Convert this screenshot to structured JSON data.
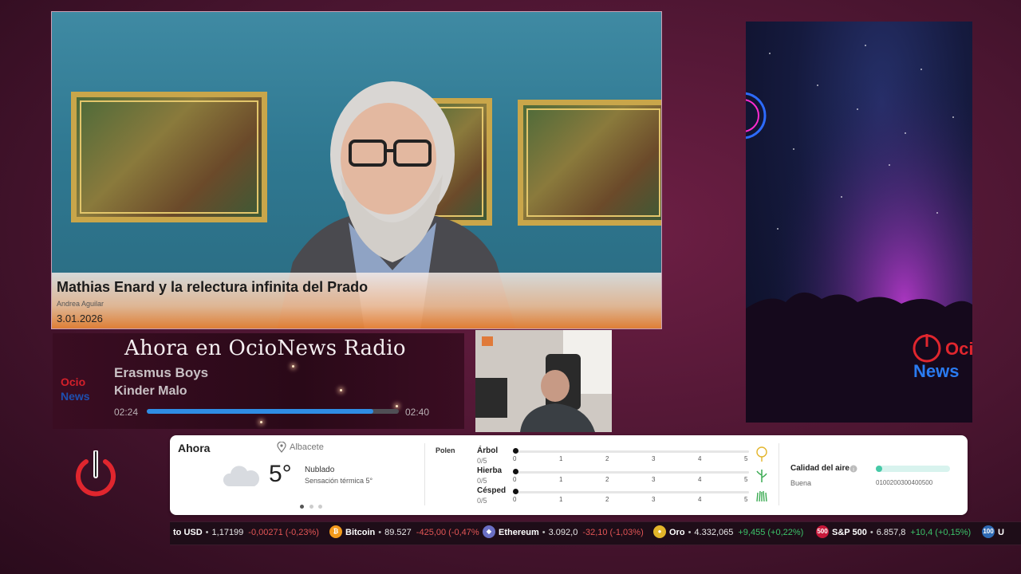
{
  "news": {
    "title": "Mathias Enard y la relectura infinita del Prado",
    "author": "Andrea Aguilar",
    "date": "3.01.2026"
  },
  "radio": {
    "heading": "Ahora en OcioNews Radio",
    "artist": "Erasmus Boys",
    "song": "Kinder Malo",
    "time_elapsed": "02:24",
    "time_total": "02:40",
    "progress_fraction": 0.9
  },
  "side_video": {
    "logo_top": "Ocio",
    "logo_bottom": "News"
  },
  "weather": {
    "now_label": "Ahora",
    "location": "Albacete",
    "temperature": "5°",
    "condition": "Nublado",
    "feels_like": "Sensación térmica 5°",
    "pollen_label": "Polen",
    "pollen": [
      {
        "name": "Árbol",
        "score": "0/5",
        "value": 0
      },
      {
        "name": "Hierba",
        "score": "0/5",
        "value": 0
      },
      {
        "name": "Césped",
        "score": "0/5",
        "value": 0
      }
    ],
    "scale": [
      "0",
      "1",
      "2",
      "3",
      "4",
      "5"
    ],
    "air_quality_label": "Calidad del aire",
    "air_quality_value": "Buena",
    "air_quality_scale": "0100200300400500"
  },
  "ticker": [
    {
      "name": "to USD",
      "value": "1,17199",
      "change": "-0,00271 (-0,23%)",
      "direction": "neg",
      "icon": ""
    },
    {
      "name": "Bitcoin",
      "value": "89.527",
      "change": "-425,00 (-0,47%",
      "direction": "neg",
      "icon": "bitcoin-icon"
    },
    {
      "name": "Ethereum",
      "value": "3.092,0",
      "change": "-32,10 (-1,03%)",
      "direction": "neg",
      "icon": "ethereum-icon"
    },
    {
      "name": "Oro",
      "value": "4.332,065",
      "change": "+9,455 (+0,22%)",
      "direction": "pos",
      "icon": "gold-icon"
    },
    {
      "name": "S&P 500",
      "value": "6.857,8",
      "change": "+10,4 (+0,15%)",
      "direction": "pos",
      "icon": "sp500-icon",
      "icon_text": "500"
    },
    {
      "name": "U",
      "value": "",
      "change": "",
      "direction": "pos",
      "icon": "index-100-icon",
      "icon_text": "100"
    }
  ],
  "colors": {
    "accent_blue": "#2f8de4",
    "negative": "#e25555",
    "positive": "#3cc36a",
    "power_red": "#e0262e"
  }
}
